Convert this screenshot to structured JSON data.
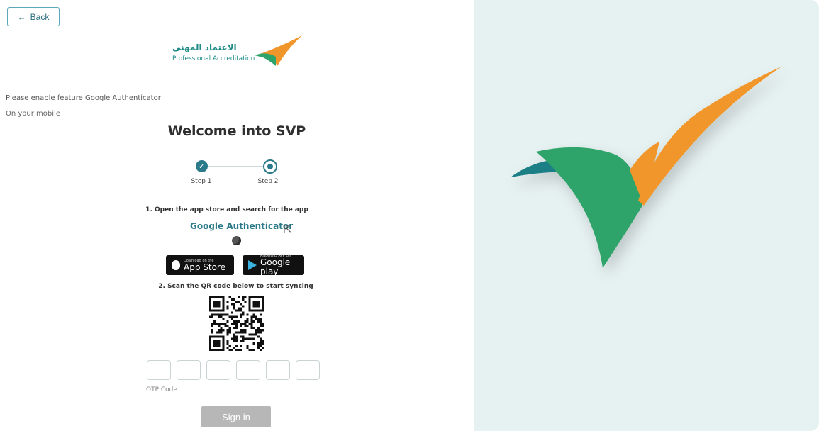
{
  "back": {
    "arrow": "←",
    "label": "Back"
  },
  "logo": {
    "arabic": "الاعتماد المهني",
    "english": "Professional Accreditation"
  },
  "hint": {
    "line1": "Please enable feature Google Authenticator",
    "line2": "On your mobile"
  },
  "title": "Welcome into SVP",
  "steps": [
    {
      "label": "Step 1",
      "status": "completed"
    },
    {
      "label": "Step 2",
      "status": "current"
    }
  ],
  "instructions": {
    "step1": "1. Open the app store and search for the app",
    "app_name": "Google Authenticator",
    "step2": "2. Scan the QR code below to start syncing"
  },
  "stores": {
    "appstore_small": "Download on the",
    "appstore_big": "App Store",
    "gplay_small": "ANDROID APP ON",
    "gplay_big": "Google play"
  },
  "otp": {
    "box_count": 6,
    "label": "OTP Code"
  },
  "signin_label": "Sign in",
  "colors": {
    "teal": "#2b7a8a",
    "green": "#2ea36a",
    "orange": "#f0962a",
    "panel_bg": "#e6f1f1"
  },
  "icons": {
    "check": "check-icon",
    "cursor": "mouse-pointer-icon"
  }
}
